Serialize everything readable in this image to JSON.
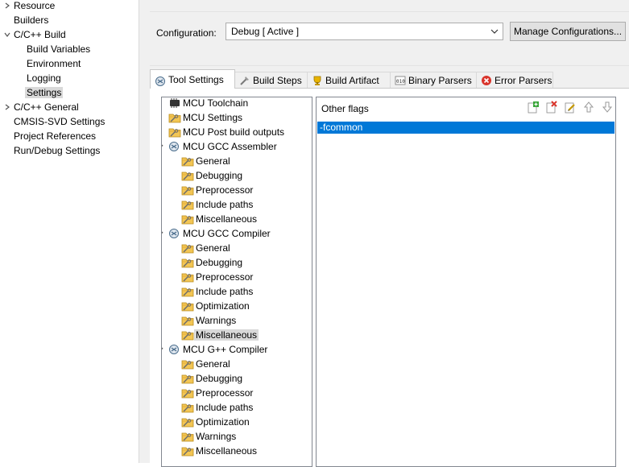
{
  "nav": {
    "items": [
      {
        "label": "Resource",
        "expander": "collapsed"
      },
      {
        "label": "Builders"
      },
      {
        "label": "C/C++ Build",
        "expander": "expanded"
      },
      {
        "label": "Build Variables"
      },
      {
        "label": "Environment"
      },
      {
        "label": "Logging"
      },
      {
        "label": "Settings",
        "selected": true
      },
      {
        "label": "C/C++ General",
        "expander": "collapsed"
      },
      {
        "label": "CMSIS-SVD Settings"
      },
      {
        "label": "Project References"
      },
      {
        "label": "Run/Debug Settings"
      }
    ]
  },
  "config": {
    "label": "Configuration:",
    "value": "Debug  [ Active ]",
    "manage_label": "Manage Configurations..."
  },
  "tabs": [
    {
      "label": "Tool Settings",
      "icon": "tool-settings-icon",
      "active": true
    },
    {
      "label": "Build Steps",
      "icon": "build-steps-icon"
    },
    {
      "label": "Build Artifact",
      "icon": "build-artifact-icon"
    },
    {
      "label": "Binary Parsers",
      "icon": "binary-parsers-icon"
    },
    {
      "label": "Error Parsers",
      "icon": "error-parsers-icon"
    }
  ],
  "tool_tree": {
    "items": [
      {
        "label": "MCU Toolchain",
        "icon": "toolchain-icon"
      },
      {
        "label": "MCU Settings",
        "icon": "settings-folder-icon"
      },
      {
        "label": "MCU Post build outputs",
        "icon": "settings-folder-icon"
      },
      {
        "label": "MCU GCC Assembler",
        "icon": "tool-icon",
        "expander": "expanded"
      },
      {
        "label": "General",
        "icon": "settings-folder-icon",
        "child": true
      },
      {
        "label": "Debugging",
        "icon": "settings-folder-icon",
        "child": true
      },
      {
        "label": "Preprocessor",
        "icon": "settings-folder-icon",
        "child": true
      },
      {
        "label": "Include paths",
        "icon": "settings-folder-icon",
        "child": true
      },
      {
        "label": "Miscellaneous",
        "icon": "settings-folder-icon",
        "child": true
      },
      {
        "label": "MCU GCC Compiler",
        "icon": "tool-icon",
        "expander": "expanded"
      },
      {
        "label": "General",
        "icon": "settings-folder-icon",
        "child": true
      },
      {
        "label": "Debugging",
        "icon": "settings-folder-icon",
        "child": true
      },
      {
        "label": "Preprocessor",
        "icon": "settings-folder-icon",
        "child": true
      },
      {
        "label": "Include paths",
        "icon": "settings-folder-icon",
        "child": true
      },
      {
        "label": "Optimization",
        "icon": "settings-folder-icon",
        "child": true
      },
      {
        "label": "Warnings",
        "icon": "settings-folder-icon",
        "child": true
      },
      {
        "label": "Miscellaneous",
        "icon": "settings-folder-icon",
        "child": true,
        "selected": true
      },
      {
        "label": "MCU G++ Compiler",
        "icon": "tool-icon",
        "expander": "expanded"
      },
      {
        "label": "General",
        "icon": "settings-folder-icon",
        "child": true
      },
      {
        "label": "Debugging",
        "icon": "settings-folder-icon",
        "child": true
      },
      {
        "label": "Preprocessor",
        "icon": "settings-folder-icon",
        "child": true
      },
      {
        "label": "Include paths",
        "icon": "settings-folder-icon",
        "child": true
      },
      {
        "label": "Optimization",
        "icon": "settings-folder-icon",
        "child": true
      },
      {
        "label": "Warnings",
        "icon": "settings-folder-icon",
        "child": true
      },
      {
        "label": "Miscellaneous",
        "icon": "settings-folder-icon",
        "child": true
      }
    ]
  },
  "flags": {
    "title": "Other flags",
    "toolbar": [
      "add-icon",
      "delete-icon",
      "edit-icon",
      "move-up-icon",
      "move-down-icon"
    ],
    "items": [
      "-fcommon"
    ]
  },
  "colors": {
    "selection": "#0078d7",
    "tree_selection": "#d9d9d9",
    "panel_bg": "#f0f0f0"
  }
}
